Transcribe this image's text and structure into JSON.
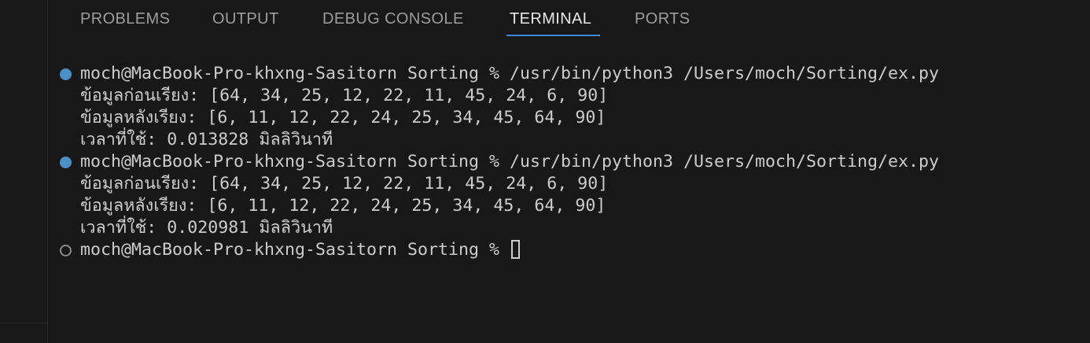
{
  "panel": {
    "tabs": [
      {
        "label": "PROBLEMS"
      },
      {
        "label": "OUTPUT"
      },
      {
        "label": "DEBUG CONSOLE"
      },
      {
        "label": "TERMINAL"
      },
      {
        "label": "PORTS"
      }
    ],
    "active_tab": "TERMINAL",
    "accent_color": "#3f87d6"
  },
  "terminal": {
    "runs": [
      {
        "status": "success",
        "prompt": "moch@MacBook-Pro-khxng-Sasitorn Sorting % /usr/bin/python3 /Users/moch/Sorting/ex.py",
        "output": [
          "ข้อมูลก่อนเรียง: [64, 34, 25, 12, 22, 11, 45, 24, 6, 90]",
          "ข้อมูลหลังเรียง: [6, 11, 12, 22, 24, 25, 34, 45, 64, 90]",
          "เวลาที่ใช้: 0.013828 มิลลิวินาที"
        ]
      },
      {
        "status": "success",
        "prompt": "moch@MacBook-Pro-khxng-Sasitorn Sorting % /usr/bin/python3 /Users/moch/Sorting/ex.py",
        "output": [
          "ข้อมูลก่อนเรียง: [64, 34, 25, 12, 22, 11, 45, 24, 6, 90]",
          "ข้อมูลหลังเรียง: [6, 11, 12, 22, 24, 25, 34, 45, 64, 90]",
          "เวลาที่ใช้: 0.020981 มิลลิวินาที"
        ]
      }
    ],
    "current_prompt": "moch@MacBook-Pro-khxng-Sasitorn Sorting % ",
    "decoration_colors": {
      "success": "#4a8fc8",
      "pending": "#8a8a8a"
    }
  }
}
